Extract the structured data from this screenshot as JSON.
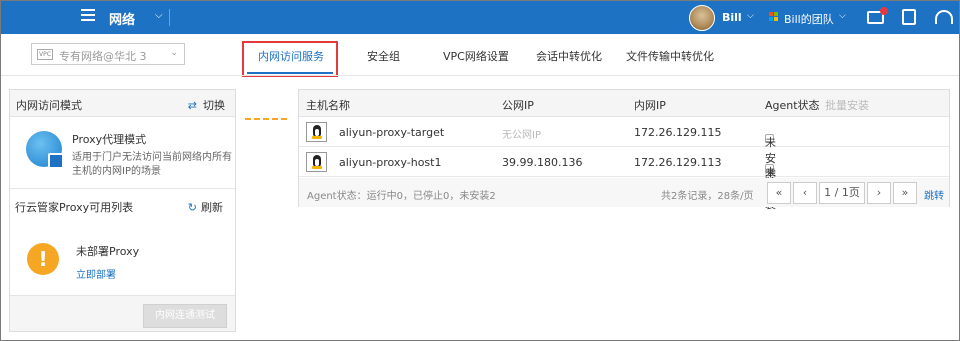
{
  "topbar": {
    "title": "网络",
    "user": "Bill",
    "team": "Bill的团队",
    "colors": {
      "bar": "#1d72c4",
      "accent_red": "#e4393c"
    },
    "icons": [
      "menu-icon",
      "envelope-icon",
      "clipboard-check-icon",
      "headset-icon"
    ]
  },
  "network_select": {
    "vpc_badge": "VPC",
    "value": "专有网络@华北 3"
  },
  "tabs": [
    {
      "label": "内网访问服务",
      "active": true
    },
    {
      "label": "安全组",
      "active": false
    },
    {
      "label": "VPC网络设置",
      "active": false
    },
    {
      "label": "会话中转优化",
      "active": false
    },
    {
      "label": "文件传输中转优化",
      "active": false
    }
  ],
  "access_mode": {
    "title": "内网访问模式",
    "switch_label": "切换",
    "mode_name": "Proxy代理模式",
    "mode_desc": "适用于门户无法访问当前网络内所有主机的内网IP的场景"
  },
  "proxy_list": {
    "title": "行云管家Proxy可用列表",
    "refresh_label": "刷新",
    "empty_text": "未部署Proxy",
    "deploy_link": "立即部署",
    "test_button": "内网连通测试"
  },
  "hosts_table": {
    "columns": {
      "name": "主机名称",
      "public_ip": "公网IP",
      "private_ip": "内网IP",
      "agent": "Agent状态",
      "batch": "批量安装"
    },
    "rows": [
      {
        "name": "aliyun-proxy-target",
        "public_ip": "无公网IP",
        "private_ip": "172.26.129.115",
        "agent": "未安装"
      },
      {
        "name": "aliyun-proxy-host1",
        "public_ip": "39.99.180.136",
        "private_ip": "172.26.129.113",
        "agent": "未安装"
      }
    ],
    "status_text": "Agent状态：运行中0，已停止0，未安装2",
    "total_text": "共2条记录，28条/页",
    "pagination": {
      "first": "«",
      "prev": "‹",
      "page": "1 / 1页",
      "next": "›",
      "last": "»",
      "jump": "跳转"
    }
  }
}
